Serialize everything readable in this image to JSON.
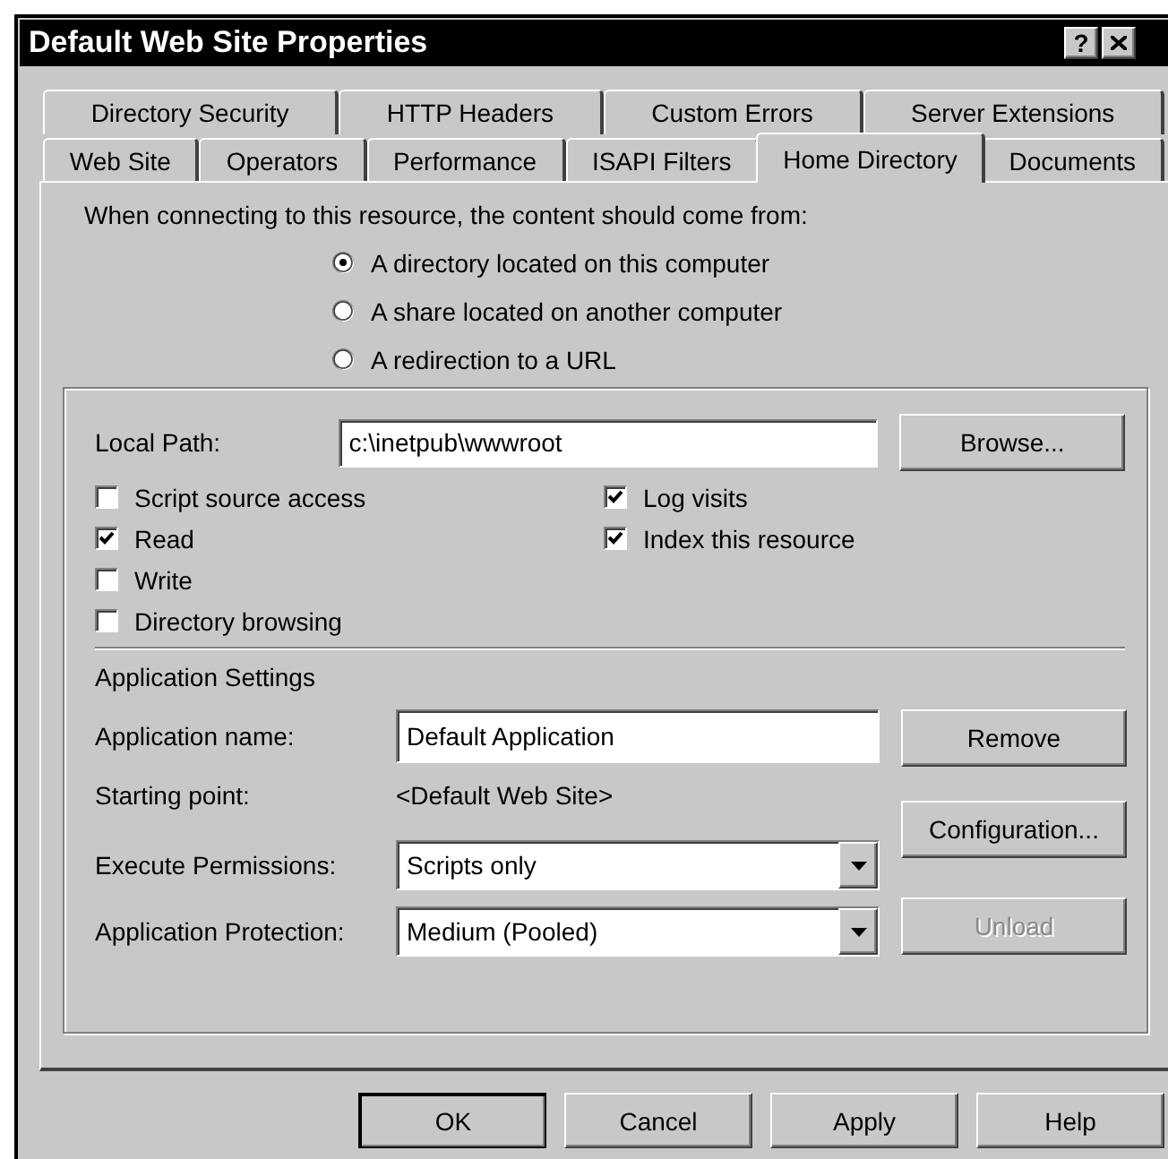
{
  "window": {
    "title": "Default Web Site Properties",
    "help_button": "?"
  },
  "tabs": {
    "back_row": [
      {
        "label": "Directory Security",
        "selected": false
      },
      {
        "label": "HTTP Headers",
        "selected": false
      },
      {
        "label": "Custom Errors",
        "selected": false
      },
      {
        "label": "Server Extensions",
        "selected": false
      }
    ],
    "front_row": [
      {
        "label": "Web Site",
        "selected": false
      },
      {
        "label": "Operators",
        "selected": false
      },
      {
        "label": "Performance",
        "selected": false
      },
      {
        "label": "ISAPI Filters",
        "selected": false
      },
      {
        "label": "Home Directory",
        "selected": true
      },
      {
        "label": "Documents",
        "selected": false
      }
    ]
  },
  "source": {
    "prompt": "When connecting to this resource, the content should come from:",
    "options": [
      {
        "label": "A directory located on this computer",
        "selected": true
      },
      {
        "label": "A share located on another computer",
        "selected": false
      },
      {
        "label": "A redirection to a URL",
        "selected": false
      }
    ]
  },
  "local_path": {
    "label": "Local Path:",
    "value": "c:\\inetpub\\wwwroot",
    "button": {
      "label": "Browse...",
      "disabled": false
    }
  },
  "permissions": {
    "left": [
      {
        "label": "Script source access",
        "checked": false
      },
      {
        "label": "Read",
        "checked": true
      },
      {
        "label": "Write",
        "checked": false
      },
      {
        "label": "Directory browsing",
        "checked": false
      }
    ],
    "right": [
      {
        "label": "Log visits",
        "checked": true
      },
      {
        "label": "Index this resource",
        "checked": true
      }
    ]
  },
  "application_settings": {
    "title": "Application Settings",
    "name_label": "Application name:",
    "name_value": "Default Application",
    "starting_point_label": "Starting point:",
    "starting_point_value": "<Default Web Site>",
    "execute_label": "Execute Permissions:",
    "execute_value": "Scripts only",
    "protection_label": "Application Protection:",
    "protection_value": "Medium (Pooled)",
    "buttons": [
      {
        "label": "Remove",
        "disabled": false
      },
      {
        "label": "Configuration...",
        "disabled": false
      },
      {
        "label": "Unload",
        "disabled": true
      }
    ]
  },
  "buttons": [
    {
      "label": "OK",
      "default": true
    },
    {
      "label": "Cancel",
      "default": false
    },
    {
      "label": "Apply",
      "default": false
    },
    {
      "label": "Help",
      "default": false
    }
  ]
}
